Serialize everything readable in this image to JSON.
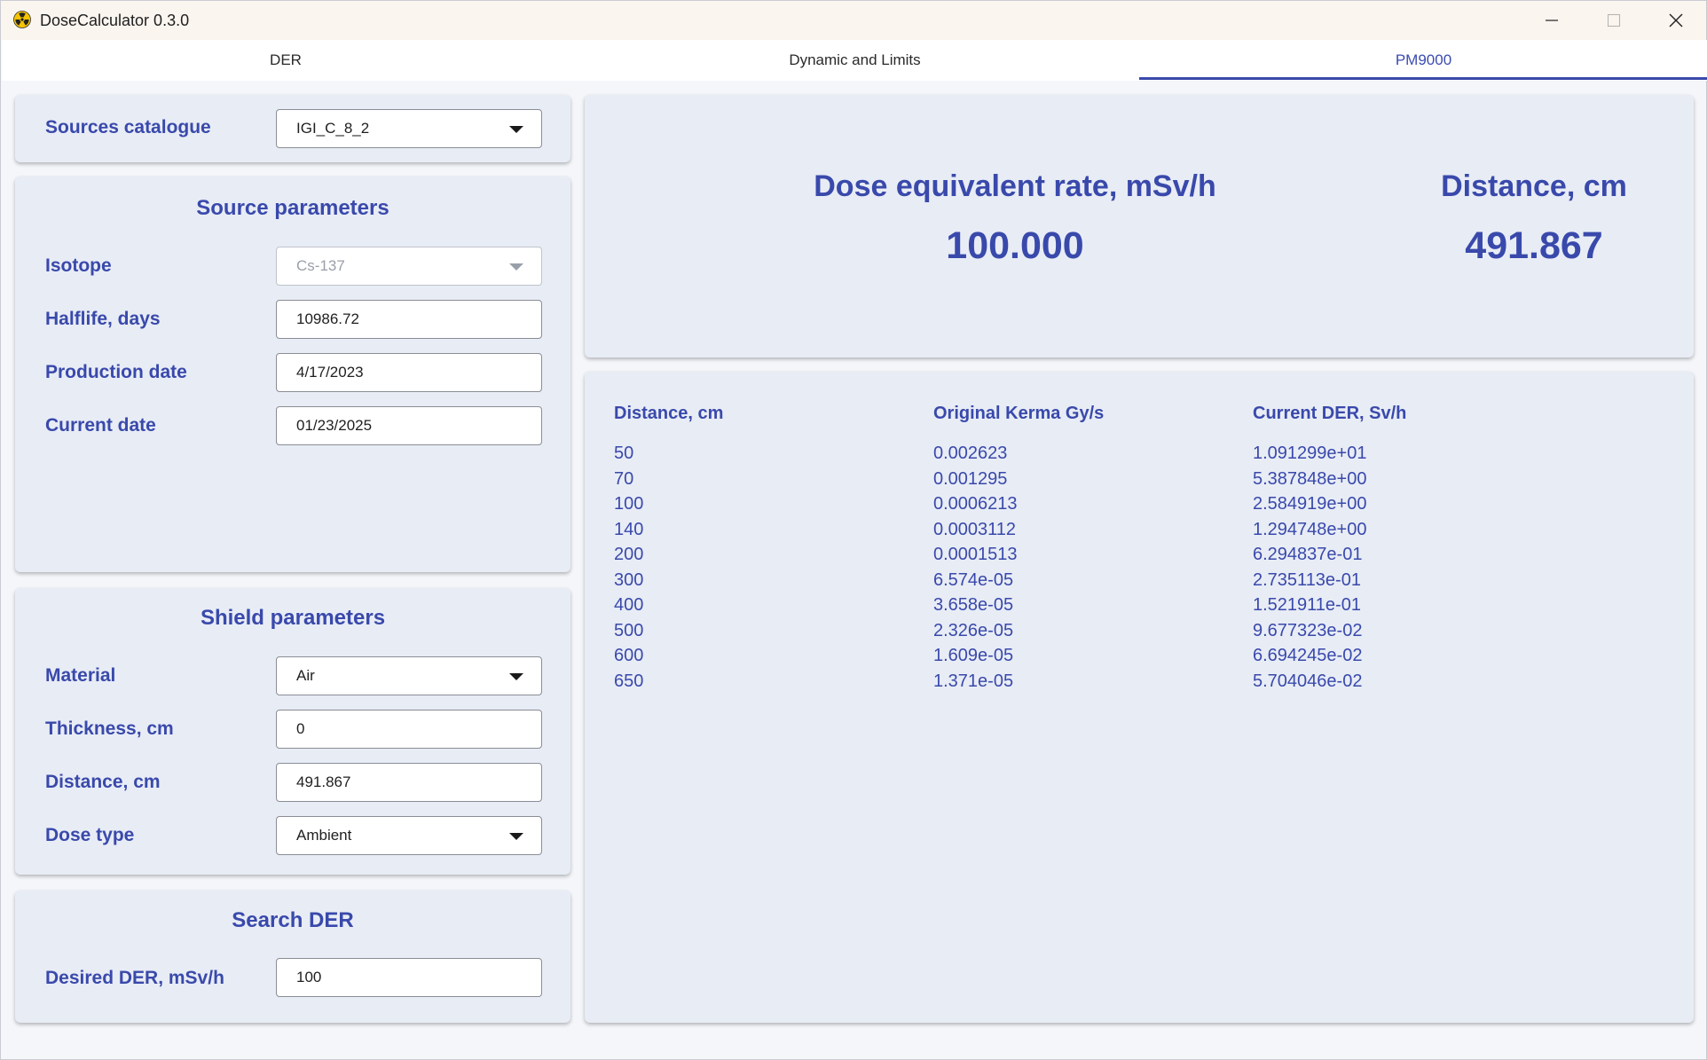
{
  "window": {
    "title": "DoseCalculator 0.3.0",
    "icon": "radiation-icon",
    "controls": {
      "minimize": "minimize-icon",
      "maximize": "maximize-icon",
      "close": "close-icon"
    }
  },
  "tabs": [
    {
      "label": "DER",
      "active": false
    },
    {
      "label": "Dynamic and Limits",
      "active": false
    },
    {
      "label": "PM9000",
      "active": true
    }
  ],
  "catalogue": {
    "label": "Sources catalogue",
    "value": "IGI_C_8_2"
  },
  "source": {
    "title": "Source parameters",
    "isotope_label": "Isotope",
    "isotope_value": "Cs-137",
    "halflife_label": "Halflife, days",
    "halflife_value": "10986.72",
    "production_label": "Production date",
    "production_value": "4/17/2023",
    "current_label": "Current date",
    "current_value": "01/23/2025"
  },
  "shield": {
    "title": "Shield parameters",
    "material_label": "Material",
    "material_value": "Air",
    "thickness_label": "Thickness, cm",
    "thickness_value": "0",
    "distance_label": "Distance, cm",
    "distance_value": "491.867",
    "dosetype_label": "Dose type",
    "dosetype_value": "Ambient"
  },
  "search": {
    "title": "Search DER",
    "desired_label": "Desired DER, mSv/h",
    "desired_value": "100"
  },
  "result": {
    "der_label": "Dose equivalent rate, mSv/h",
    "der_value": "100.000",
    "distance_label": "Distance, cm",
    "distance_value": "491.867"
  },
  "table": {
    "headers": [
      "Distance, cm",
      "Original Kerma Gy/s",
      "Current DER, Sv/h"
    ],
    "rows": [
      [
        "50",
        "0.002623",
        "1.091299e+01"
      ],
      [
        "70",
        "0.001295",
        "5.387848e+00"
      ],
      [
        "100",
        "0.0006213",
        "2.584919e+00"
      ],
      [
        "140",
        "0.0003112",
        "1.294748e+00"
      ],
      [
        "200",
        "0.0001513",
        "6.294837e-01"
      ],
      [
        "300",
        "6.574e-05",
        "2.735113e-01"
      ],
      [
        "400",
        "3.658e-05",
        "1.521911e-01"
      ],
      [
        "500",
        "2.326e-05",
        "9.677323e-02"
      ],
      [
        "600",
        "1.609e-05",
        "6.694245e-02"
      ],
      [
        "650",
        "1.371e-05",
        "5.704046e-02"
      ]
    ]
  },
  "colors": {
    "accent": "#3949ab",
    "panel": "#e8ecf5",
    "titlebar": "#fbf5ef"
  }
}
